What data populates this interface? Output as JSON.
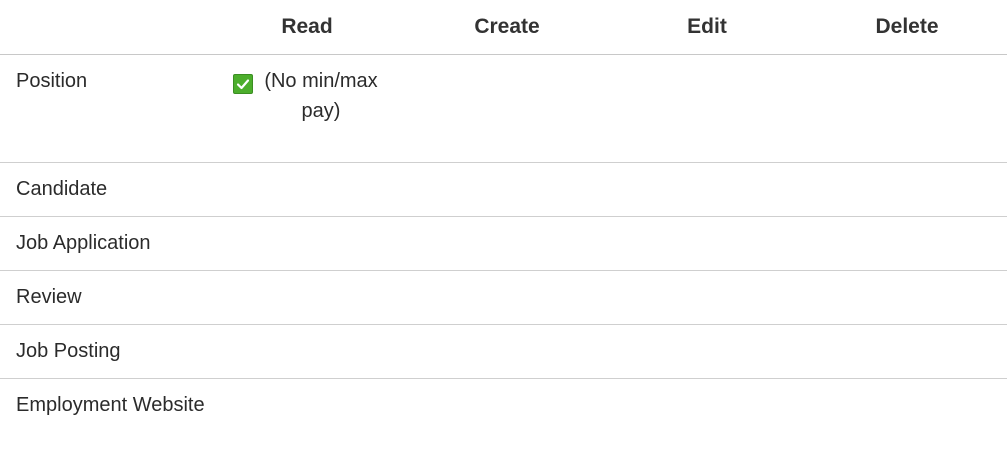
{
  "headers": [
    "",
    "Read",
    "Create",
    "Edit",
    "Delete"
  ],
  "rows": [
    {
      "object": "Position",
      "read_note": "(No min/max pay)",
      "read_checked": true
    },
    {
      "object": "Candidate"
    },
    {
      "object": "Job Application"
    },
    {
      "object": "Review"
    },
    {
      "object": "Job Posting"
    },
    {
      "object": "Employment Website"
    }
  ],
  "colors": {
    "checkbox_fill": "#4cae2c",
    "border": "#cfcfcf"
  },
  "icons": {
    "read_permission": "checkbox-checked-icon"
  }
}
